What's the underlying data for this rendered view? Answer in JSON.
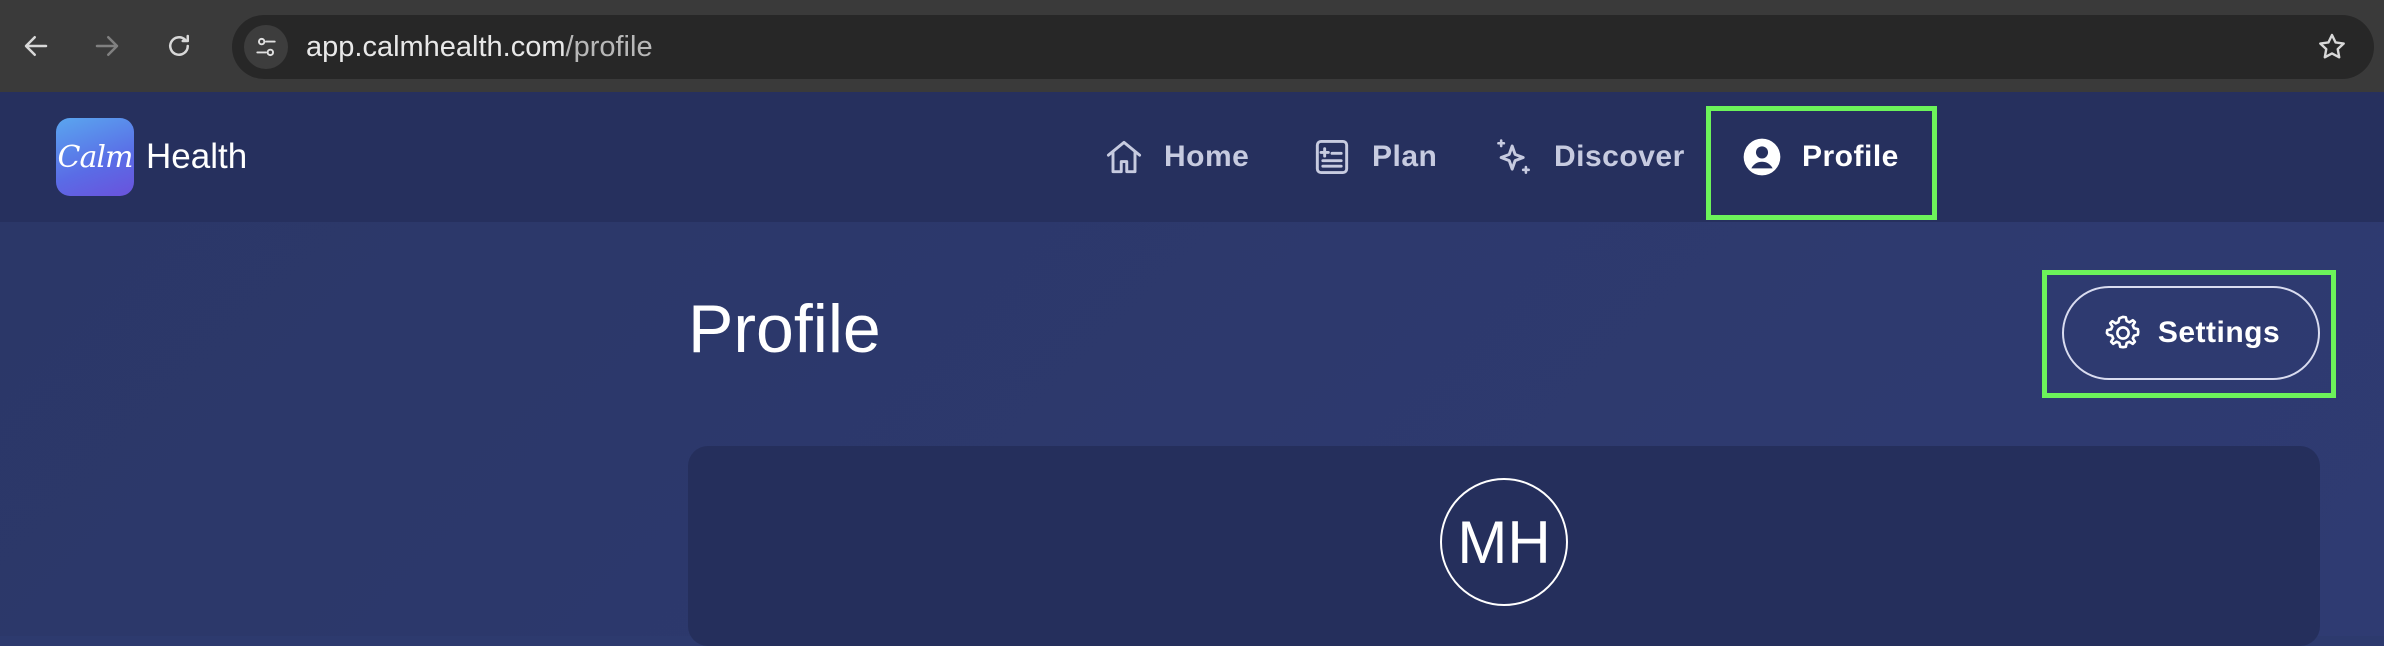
{
  "browser": {
    "url_host": "app.calmhealth.com",
    "url_path": "/profile"
  },
  "app": {
    "logo_text": "Calm",
    "brand_name": "Health"
  },
  "nav": {
    "items": [
      {
        "label": "Home",
        "icon": "home-icon"
      },
      {
        "label": "Plan",
        "icon": "plan-icon"
      },
      {
        "label": "Discover",
        "icon": "sparkle-icon"
      },
      {
        "label": "Profile",
        "icon": "user-circle-icon",
        "active": true
      }
    ]
  },
  "page": {
    "title": "Profile",
    "settings_label": "Settings",
    "avatar_initials": "MH"
  },
  "colors": {
    "header_bg": "#26305e",
    "page_bg": "#2d3a6e",
    "card_bg": "#252f5c",
    "highlight": "#6cf35a"
  }
}
